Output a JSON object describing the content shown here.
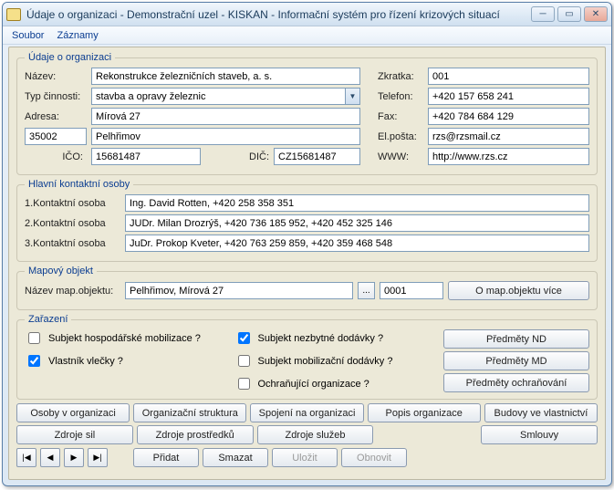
{
  "window": {
    "title": "Údaje o organizaci - Demonstrační uzel - KISKAN - Informační systém pro řízení krizových situací"
  },
  "menu": {
    "soubor": "Soubor",
    "zaznamy": "Záznamy"
  },
  "org": {
    "legend": "Údaje o organizaci",
    "nazev_lbl": "Název:",
    "nazev": "Rekonstrukce železničních staveb, a. s.",
    "zkratka_lbl": "Zkratka:",
    "zkratka": "001",
    "typ_lbl": "Typ činnosti:",
    "typ": "stavba a opravy železnic",
    "telefon_lbl": "Telefon:",
    "telefon": "+420 157 658 241",
    "adresa_lbl": "Adresa:",
    "adresa": "Mírová 27",
    "fax_lbl": "Fax:",
    "fax": "+420 784 684 129",
    "psc": "35002",
    "mesto": "Pelhřimov",
    "email_lbl": "El.pošta:",
    "email": "rzs@rzsmail.cz",
    "ico_lbl": "IČO:",
    "ico": "15681487",
    "dic_lbl": "DIČ:",
    "dic": "CZ15681487",
    "www_lbl": "WWW:",
    "www": "http://www.rzs.cz"
  },
  "kontakt": {
    "legend": "Hlavní kontaktní osoby",
    "lbl1": "1.Kontaktní osoba",
    "v1": "Ing. David Rotten, +420 258 358 351",
    "lbl2": "2.Kontaktní osoba",
    "v2": "JUDr. Milan Drozrýš, +420 736 185 952, +420 452 325 146",
    "lbl3": "3.Kontaktní osoba",
    "v3": "JuDr. Prokop Kveter, +420 763 259 859, +420 359 468 548"
  },
  "map": {
    "legend": "Mapový objekt",
    "lbl": "Název map.objektu:",
    "nazev": "Pelhřimov, Mírová 27",
    "kod": "0001",
    "btn": "O map.objektu více"
  },
  "zarazeni": {
    "legend": "Zařazení",
    "c1": "Subjekt hospodářské mobilizace ?",
    "c2": "Vlastník vlečky ?",
    "c3": "Subjekt nezbytné dodávky ?",
    "c4": "Subjekt mobilizační dodávky ?",
    "c5": "Ochraňující organizace ?",
    "b1": "Předměty ND",
    "b2": "Předměty MD",
    "b3": "Předměty ochraňování"
  },
  "btns": {
    "r1": [
      "Osoby v organizaci",
      "Organizační struktura",
      "Spojení na organizaci",
      "Popis organizace",
      "Budovy ve vlastnictví"
    ],
    "r2": [
      "Zdroje sil",
      "Zdroje prostředků",
      "Zdroje služeb",
      "",
      "Smlouvy"
    ]
  },
  "nav": {
    "pridat": "Přidat",
    "smazat": "Smazat",
    "ulozit": "Uložit",
    "obnovit": "Obnovit"
  }
}
